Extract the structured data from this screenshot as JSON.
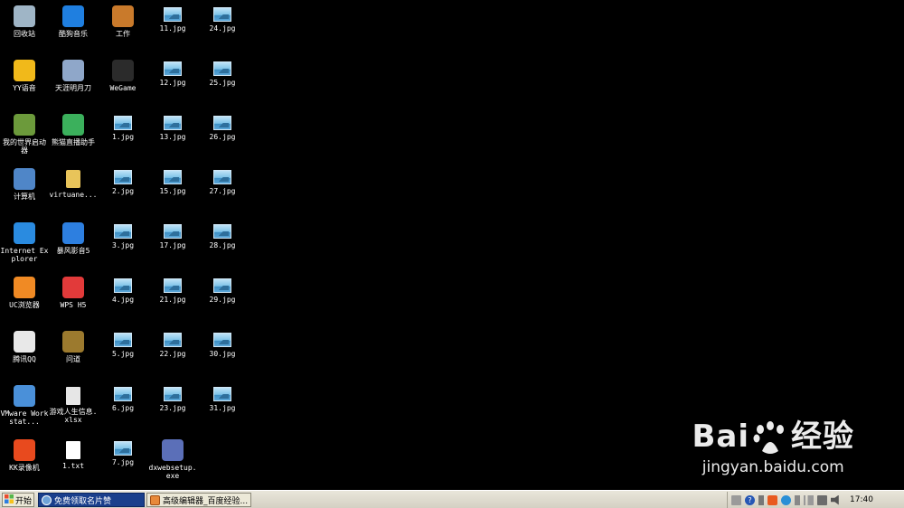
{
  "desktop": {
    "icons": [
      {
        "label": "回收站",
        "icon": "recycle-bin-icon"
      },
      {
        "label": "酷狗音乐",
        "icon": "kugou-music-icon"
      },
      {
        "label": "工作",
        "icon": "briefcase-icon"
      },
      {
        "label": "11.jpg",
        "icon": "image-file-icon"
      },
      {
        "label": "24.jpg",
        "icon": "image-file-icon"
      },
      {
        "label": "YY语音",
        "icon": "yy-voice-icon"
      },
      {
        "label": "天涯明月刀",
        "icon": "tianya-game-icon"
      },
      {
        "label": "WeGame",
        "icon": "wegame-icon"
      },
      {
        "label": "12.jpg",
        "icon": "image-file-icon"
      },
      {
        "label": "25.jpg",
        "icon": "image-file-icon"
      },
      {
        "label": "我的世界启动器",
        "icon": "minecraft-launcher-icon"
      },
      {
        "label": "熊猫直播助手",
        "icon": "panda-live-icon"
      },
      {
        "label": "1.jpg",
        "icon": "image-file-icon"
      },
      {
        "label": "13.jpg",
        "icon": "image-file-icon"
      },
      {
        "label": "26.jpg",
        "icon": "image-file-icon"
      },
      {
        "label": "计算机",
        "icon": "computer-icon"
      },
      {
        "label": "virtuane...",
        "icon": "folder-icon"
      },
      {
        "label": "2.jpg",
        "icon": "image-file-icon"
      },
      {
        "label": "15.jpg",
        "icon": "image-file-icon"
      },
      {
        "label": "27.jpg",
        "icon": "image-file-icon"
      },
      {
        "label": "Internet Explorer",
        "icon": "internet-explorer-icon"
      },
      {
        "label": "暴风影音5",
        "icon": "baofeng-player-icon"
      },
      {
        "label": "3.jpg",
        "icon": "image-file-icon"
      },
      {
        "label": "17.jpg",
        "icon": "image-file-icon"
      },
      {
        "label": "28.jpg",
        "icon": "image-file-icon"
      },
      {
        "label": "UC浏览器",
        "icon": "uc-browser-icon"
      },
      {
        "label": "WPS H5",
        "icon": "wps-h5-icon"
      },
      {
        "label": "4.jpg",
        "icon": "image-file-icon"
      },
      {
        "label": "21.jpg",
        "icon": "image-file-icon"
      },
      {
        "label": "29.jpg",
        "icon": "image-file-icon"
      },
      {
        "label": "腾讯QQ",
        "icon": "qq-icon"
      },
      {
        "label": "问道",
        "icon": "wendao-game-icon"
      },
      {
        "label": "5.jpg",
        "icon": "image-file-icon"
      },
      {
        "label": "22.jpg",
        "icon": "image-file-icon"
      },
      {
        "label": "30.jpg",
        "icon": "image-file-icon"
      },
      {
        "label": "VMware Workstat...",
        "icon": "vmware-icon"
      },
      {
        "label": "游戏人生信息.xlsx",
        "icon": "excel-file-icon"
      },
      {
        "label": "6.jpg",
        "icon": "image-file-icon"
      },
      {
        "label": "23.jpg",
        "icon": "image-file-icon"
      },
      {
        "label": "31.jpg",
        "icon": "image-file-icon"
      },
      {
        "label": "KK录像机",
        "icon": "kk-recorder-icon"
      },
      {
        "label": "1.txt",
        "icon": "text-file-icon"
      },
      {
        "label": "7.jpg",
        "icon": "image-file-icon"
      },
      {
        "label": "dxwebsetup.exe",
        "icon": "installer-icon"
      }
    ]
  },
  "taskbar": {
    "start_label": "开始",
    "tasks": [
      {
        "label": "免费领取名片赞",
        "active": true
      },
      {
        "label": "高级编辑器_百度经验...",
        "active": false
      }
    ],
    "clock": "17:40"
  },
  "watermark": {
    "brand": "Bai",
    "brand_suffix": "经验",
    "url": "jingyan.baidu.com"
  },
  "colors": {
    "desktop_bg": "#000000",
    "taskbar_bg": "#d4d0c3",
    "active_task": "#1a3f8c"
  }
}
